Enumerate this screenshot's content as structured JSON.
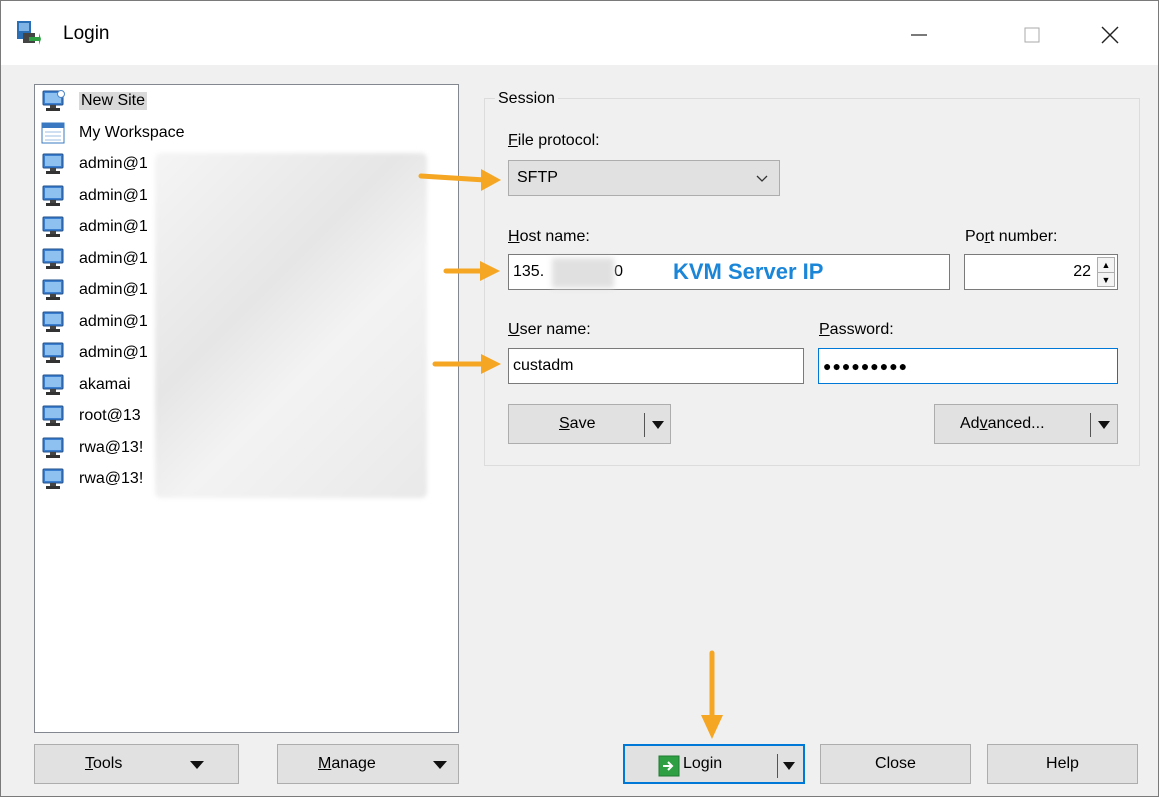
{
  "window": {
    "title": "Login"
  },
  "sites": [
    {
      "label": "New Site",
      "icon": "new-site-icon",
      "selected": true
    },
    {
      "label": "My Workspace",
      "icon": "workspace-icon"
    },
    {
      "label": "admin@1",
      "icon": "computer-icon"
    },
    {
      "label": "admin@1",
      "icon": "computer-icon"
    },
    {
      "label": "admin@1",
      "icon": "computer-icon"
    },
    {
      "label": "admin@1",
      "icon": "computer-icon"
    },
    {
      "label": "admin@1",
      "icon": "computer-icon"
    },
    {
      "label": "admin@1",
      "icon": "computer-icon"
    },
    {
      "label": "admin@1",
      "icon": "computer-icon"
    },
    {
      "label": "akamai",
      "icon": "computer-icon"
    },
    {
      "label": "root@13",
      "icon": "computer-icon"
    },
    {
      "label": "rwa@13!",
      "icon": "computer-icon"
    },
    {
      "label": "rwa@13!",
      "icon": "computer-icon"
    }
  ],
  "session": {
    "legend": "Session",
    "file_protocol_label_prefix": "F",
    "file_protocol_label_rest": "ile protocol:",
    "file_protocol_value": "SFTP",
    "host_label_prefix": "H",
    "host_label_rest": "ost name:",
    "host_value_start": "135.",
    "host_value_end": "0",
    "port_label_prefix": "Po",
    "port_label_u": "r",
    "port_label_rest": "t number:",
    "port_value": "22",
    "user_label_prefix": "U",
    "user_label_rest": "ser name:",
    "user_value": "custadm",
    "password_label_prefix": "P",
    "password_label_rest": "assword:",
    "password_value": "●●●●●●●●●",
    "save_prefix": "S",
    "save_rest": "ave",
    "advanced_prefix": "Ad",
    "advanced_u": "v",
    "advanced_rest": "anced..."
  },
  "annotation": {
    "kvm_label": "KVM Server IP",
    "color": "#1b86d8",
    "arrow_color": "#f5a623"
  },
  "buttons": {
    "tools_prefix": "T",
    "tools_rest": "ools",
    "manage_prefix": "M",
    "manage_rest": "anage",
    "login": "Login",
    "close": "Close",
    "help": "Help"
  }
}
